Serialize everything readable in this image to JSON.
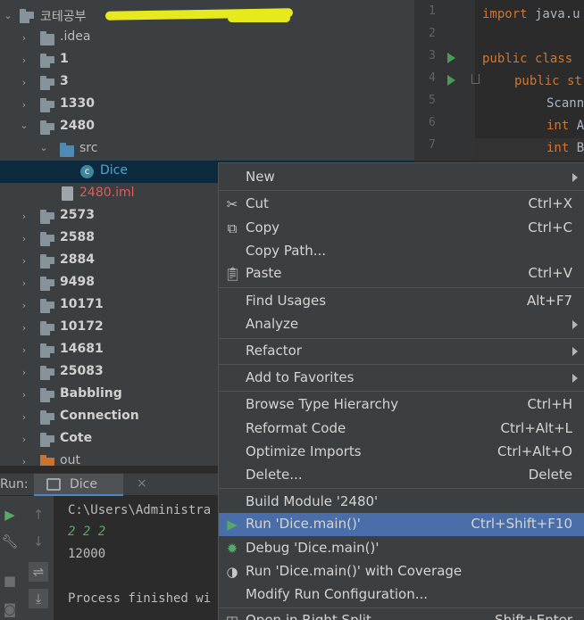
{
  "tree": {
    "root": "코테공부",
    "items": [
      {
        "label": ".idea"
      },
      {
        "label": "1"
      },
      {
        "label": "3"
      },
      {
        "label": "1330"
      },
      {
        "label": "2480"
      },
      {
        "label": "src"
      },
      {
        "label": "Dice"
      },
      {
        "label": "2480.iml"
      },
      {
        "label": "2573"
      },
      {
        "label": "2588"
      },
      {
        "label": "2884"
      },
      {
        "label": "9498"
      },
      {
        "label": "10171"
      },
      {
        "label": "10172"
      },
      {
        "label": "14681"
      },
      {
        "label": "25083"
      },
      {
        "label": "Babbling"
      },
      {
        "label": "Connection"
      },
      {
        "label": "Cote"
      },
      {
        "label": "out"
      }
    ]
  },
  "editor": {
    "line_numbers": [
      "1",
      "2",
      "3",
      "4",
      "5",
      "6",
      "7"
    ],
    "lines": [
      {
        "kw": "import",
        "rest": " java.u"
      },
      {
        "kw": "",
        "rest": ""
      },
      {
        "kw": "public class",
        "rest": ""
      },
      {
        "kw": "public st",
        "rest": ""
      },
      {
        "kw": "",
        "rest": "Scann"
      },
      {
        "kw": "int",
        "rest": " A"
      },
      {
        "kw": "int",
        "rest": " B"
      }
    ]
  },
  "run": {
    "label": "Run:",
    "tab": "Dice",
    "tab_close": "×",
    "console": [
      "C:\\Users\\Administra",
      "2 2 2",
      "12000",
      "",
      "Process finished wi"
    ]
  },
  "menu": {
    "items": [
      {
        "label": "New",
        "key": ""
      },
      {
        "label": "Cut",
        "key": "Ctrl+X"
      },
      {
        "label": "Copy",
        "key": "Ctrl+C"
      },
      {
        "label": "Copy Path...",
        "key": ""
      },
      {
        "label": "Paste",
        "key": "Ctrl+V"
      },
      {
        "label": "Find Usages",
        "key": "Alt+F7"
      },
      {
        "label": "Analyze",
        "key": ""
      },
      {
        "label": "Refactor",
        "key": ""
      },
      {
        "label": "Add to Favorites",
        "key": ""
      },
      {
        "label": "Browse Type Hierarchy",
        "key": "Ctrl+H"
      },
      {
        "label": "Reformat Code",
        "key": "Ctrl+Alt+L"
      },
      {
        "label": "Optimize Imports",
        "key": "Ctrl+Alt+O"
      },
      {
        "label": "Delete...",
        "key": "Delete"
      },
      {
        "label": "Build Module '2480'",
        "key": ""
      },
      {
        "label": "Run 'Dice.main()'",
        "key": "Ctrl+Shift+F10"
      },
      {
        "label": "Debug 'Dice.main()'",
        "key": ""
      },
      {
        "label": "Run 'Dice.main()' with Coverage",
        "key": ""
      },
      {
        "label": "Modify Run Configuration...",
        "key": ""
      },
      {
        "label": "Open in Right Split",
        "key": "Shift+Enter"
      }
    ]
  },
  "colors": {
    "background": "#2b2b2b",
    "panel": "#3c3f41",
    "selection": "#4a6ea9",
    "keyword": "#cc7832",
    "run_green": "#59a869"
  }
}
